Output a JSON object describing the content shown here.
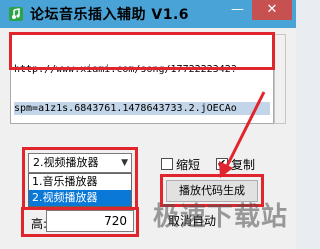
{
  "window": {
    "title": "论坛音乐插入辅助 V1.6",
    "min_label": "—",
    "close_label": "✕"
  },
  "url_text": {
    "line1": "http://www.xiami.com/song/1772222342?",
    "line2": "spm=a1z1s.6843761.1478643733.2.jOECAo"
  },
  "player_select": {
    "value": "2.视频播放器",
    "options": [
      "1.音乐播放器",
      "2.视频播放器"
    ],
    "selected_index": 1
  },
  "checkboxes": {
    "shorten_label": "缩短",
    "shorten_checked": false,
    "copy_label": "复制",
    "copy_checked": true
  },
  "generate_button": "播放代码生成",
  "height": {
    "label": "高:",
    "value": "720"
  },
  "cancel_text": "取消自动",
  "watermark": "极速下载站",
  "colors": {
    "titlebar": "#49a3d7",
    "highlight": "#e0262c",
    "close": "#c75050",
    "selected_option": "#0a78d7"
  }
}
